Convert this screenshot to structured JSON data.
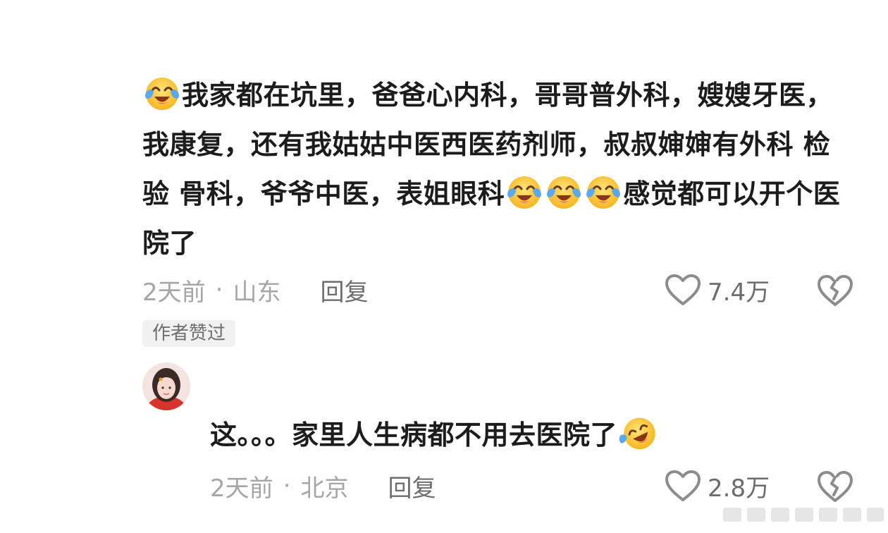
{
  "comment": {
    "text_parts": [
      "我家都在坑里，爸爸心内科，哥哥普外科，嫂嫂牙医，我康复，还有我姑姑中医西医药剂师，叔叔婶婶有外科 检验 骨科，爷爷中医，表姐眼科",
      "感觉都可以开个医院了"
    ],
    "time": "2天前",
    "separator": "·",
    "location": "山东",
    "reply_label": "回复",
    "likes": "7.4万",
    "author_badge": "作者赞过"
  },
  "reply": {
    "text": "这。。。家里人生病都不用去医院了",
    "time": "2天前",
    "separator": "·",
    "location": "北京",
    "reply_label": "回复",
    "likes": "2.8万"
  },
  "icons": {
    "emoji_crying_laughing": "crying-laughing-emoji-icon",
    "emoji_rofl": "rolling-laughing-emoji-icon",
    "like": "heart-icon",
    "dislike": "broken-heart-icon"
  },
  "colors": {
    "text": "#1c1c1c",
    "meta": "#a6a6a6",
    "action": "#6d6d6d",
    "badge_bg": "#f1f1f1"
  }
}
